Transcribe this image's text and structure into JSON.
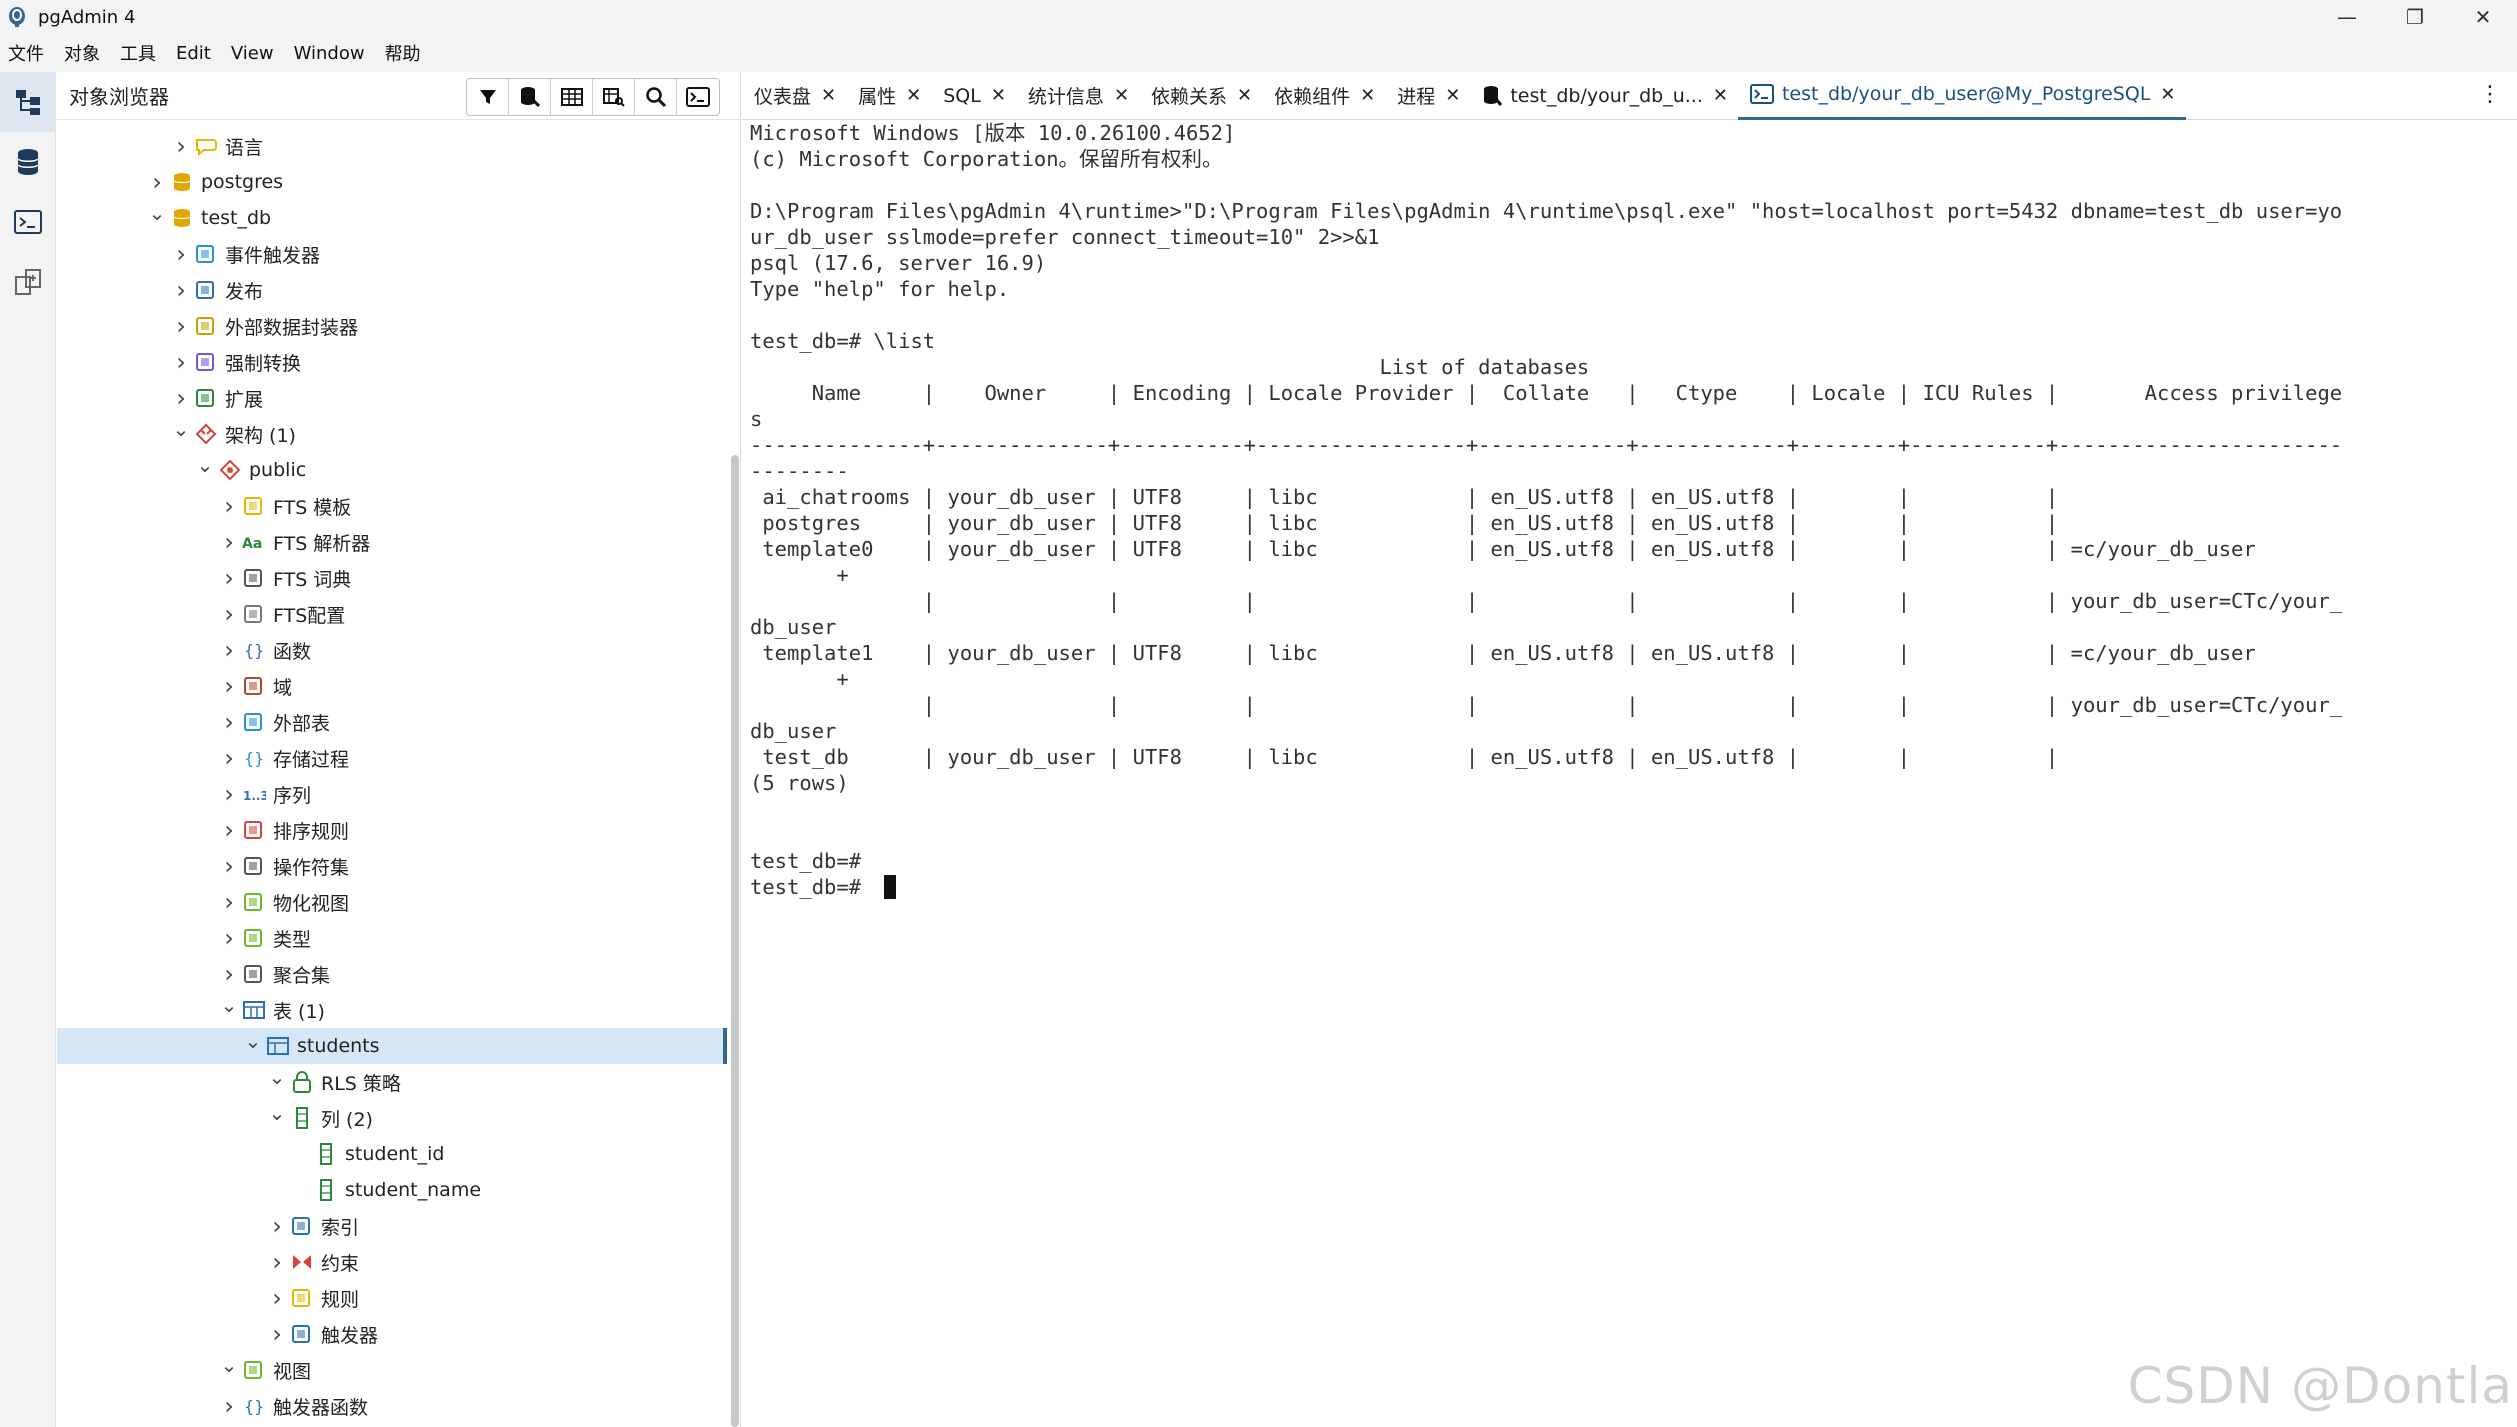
{
  "window": {
    "title": "pgAdmin 4",
    "controls": [
      "—",
      "❐",
      "✕"
    ]
  },
  "menubar": [
    "文件",
    "对象",
    "工具",
    "Edit",
    "View",
    "Window",
    "帮助"
  ],
  "rail": [
    "object-explorer-icon",
    "database-icon",
    "psql-tool-icon",
    "schema-diff-icon"
  ],
  "browser": {
    "title": "对象浏览器",
    "tools": [
      "filter-icon",
      "query-tool-icon",
      "view-data-icon",
      "search-objects-icon",
      "search-icon",
      "psql-icon"
    ],
    "tree": [
      {
        "label": "语言",
        "chev": "closed",
        "icon": "language-icon",
        "color": "#e6b800"
      },
      {
        "label": "postgres",
        "chev": "closed",
        "icon": "database-icon",
        "color": "#e0a800"
      },
      {
        "label": "test_db",
        "chev": "open",
        "icon": "database-icon",
        "color": "#e0a800"
      },
      {
        "label": "事件触发器",
        "chev": "closed",
        "icon": "event-trigger-icon",
        "color": "#2b8fd6"
      },
      {
        "label": "发布",
        "chev": "closed",
        "icon": "publication-icon",
        "color": "#2b6fb6"
      },
      {
        "label": "外部数据封装器",
        "chev": "closed",
        "icon": "fdw-icon",
        "color": "#c9a000"
      },
      {
        "label": "强制转换",
        "chev": "closed",
        "icon": "cast-icon",
        "color": "#6b5bd6"
      },
      {
        "label": "扩展",
        "chev": "closed",
        "icon": "extension-icon",
        "color": "#2a8a3a"
      },
      {
        "label": "架构 (1)",
        "chev": "open",
        "icon": "schemas-icon",
        "color": "#d9443a"
      },
      {
        "label": "public",
        "chev": "open",
        "icon": "schema-icon",
        "color": "#d9443a"
      },
      {
        "label": "FTS 模板",
        "chev": "closed",
        "icon": "fts-template-icon",
        "color": "#e6b800"
      },
      {
        "label": "FTS 解析器",
        "chev": "closed",
        "icon": "fts-parser-icon",
        "color": "#2a8a3a"
      },
      {
        "label": "FTS 词典",
        "chev": "closed",
        "icon": "fts-dictionary-icon",
        "color": "#555555"
      },
      {
        "label": "FTS配置",
        "chev": "closed",
        "icon": "fts-config-icon",
        "color": "#777777"
      },
      {
        "label": "函数",
        "chev": "closed",
        "icon": "function-icon",
        "color": "#2b6fb6"
      },
      {
        "label": "域",
        "chev": "closed",
        "icon": "domain-icon",
        "color": "#b04a2a"
      },
      {
        "label": "外部表",
        "chev": "closed",
        "icon": "foreign-table-icon",
        "color": "#2b8fd6"
      },
      {
        "label": "存储过程",
        "chev": "closed",
        "icon": "procedure-icon",
        "color": "#2b8fd6"
      },
      {
        "label": "序列",
        "chev": "closed",
        "icon": "sequence-icon",
        "color": "#2b6fb6"
      },
      {
        "label": "排序规则",
        "chev": "closed",
        "icon": "collation-icon",
        "color": "#d9443a"
      },
      {
        "label": "操作符集",
        "chev": "closed",
        "icon": "operator-icon",
        "color": "#555555"
      },
      {
        "label": "物化视图",
        "chev": "closed",
        "icon": "materialized-view-icon",
        "color": "#6cb82a"
      },
      {
        "label": "类型",
        "chev": "closed",
        "icon": "type-icon",
        "color": "#6cb82a"
      },
      {
        "label": "聚合集",
        "chev": "closed",
        "icon": "aggregate-icon",
        "color": "#555555"
      },
      {
        "label": "表 (1)",
        "chev": "open",
        "icon": "tables-icon",
        "color": "#2b6fb6"
      },
      {
        "label": "students",
        "chev": "open",
        "icon": "table-icon",
        "color": "#2b6fb6",
        "selected": true
      },
      {
        "label": "RLS 策略",
        "chev": "open",
        "icon": "rls-policy-icon",
        "color": "#2a8a3a"
      },
      {
        "label": "列 (2)",
        "chev": "open",
        "icon": "columns-icon",
        "color": "#2a8a3a"
      },
      {
        "label": "student_id",
        "chev": "none",
        "icon": "column-icon",
        "color": "#2a8a3a"
      },
      {
        "label": "student_name",
        "chev": "none",
        "icon": "column-icon",
        "color": "#2a8a3a"
      },
      {
        "label": "索引",
        "chev": "closed",
        "icon": "index-icon",
        "color": "#2b6fb6"
      },
      {
        "label": "约束",
        "chev": "closed",
        "icon": "constraint-icon",
        "color": "#d9443a"
      },
      {
        "label": "规则",
        "chev": "closed",
        "icon": "rule-icon",
        "color": "#e6b800"
      },
      {
        "label": "触发器",
        "chev": "closed",
        "icon": "trigger-icon",
        "color": "#2b6fb6"
      },
      {
        "label": "视图",
        "chev": "open",
        "icon": "view-icon",
        "color": "#6cb82a"
      },
      {
        "label": "触发器函数",
        "chev": "closed",
        "icon": "trigger-function-icon",
        "color": "#2b6fb6"
      }
    ]
  },
  "tabs": [
    {
      "label": "仪表盘"
    },
    {
      "label": "属性"
    },
    {
      "label": "SQL"
    },
    {
      "label": "统计信息"
    },
    {
      "label": "依赖关系"
    },
    {
      "label": "依赖组件"
    },
    {
      "label": "进程"
    },
    {
      "label": "test_db/your_db_u...",
      "icon": "query-tool-icon"
    },
    {
      "label": "test_db/your_db_user@My_PostgreSQL",
      "icon": "psql-icon",
      "active": true
    }
  ],
  "terminal": {
    "lines": [
      "Microsoft Windows [版本 10.0.26100.4652]",
      "(c) Microsoft Corporation。保留所有权利。",
      "",
      "D:\\Program Files\\pgAdmin 4\\runtime>\"D:\\Program Files\\pgAdmin 4\\runtime\\psql.exe\" \"host=localhost port=5432 dbname=test_db user=yo",
      "ur_db_user sslmode=prefer connect_timeout=10\" 2>>&1",
      "psql (17.6, server 16.9)",
      "Type \"help\" for help.",
      "",
      "test_db=# \\list",
      "                                                   List of databases",
      "     Name     |    Owner     | Encoding | Locale Provider |  Collate   |   Ctype    | Locale | ICU Rules |       Access privilege",
      "s",
      "--------------+--------------+----------+-----------------+------------+------------+--------+-----------+-----------------------",
      "--------",
      " ai_chatrooms | your_db_user | UTF8     | libc            | en_US.utf8 | en_US.utf8 |        |           |",
      " postgres     | your_db_user | UTF8     | libc            | en_US.utf8 | en_US.utf8 |        |           |",
      " template0    | your_db_user | UTF8     | libc            | en_US.utf8 | en_US.utf8 |        |           | =c/your_db_user",
      "       +",
      "              |              |          |                 |            |            |        |           | your_db_user=CTc/your_",
      "db_user",
      " template1    | your_db_user | UTF8     | libc            | en_US.utf8 | en_US.utf8 |        |           | =c/your_db_user",
      "       +",
      "              |              |          |                 |            |            |        |           | your_db_user=CTc/your_",
      "db_user",
      " test_db      | your_db_user | UTF8     | libc            | en_US.utf8 | en_US.utf8 |        |           |",
      "(5 rows)",
      "",
      "",
      "test_db=#",
      "test_db=# "
    ]
  },
  "watermark": "CSDN @Dontla"
}
